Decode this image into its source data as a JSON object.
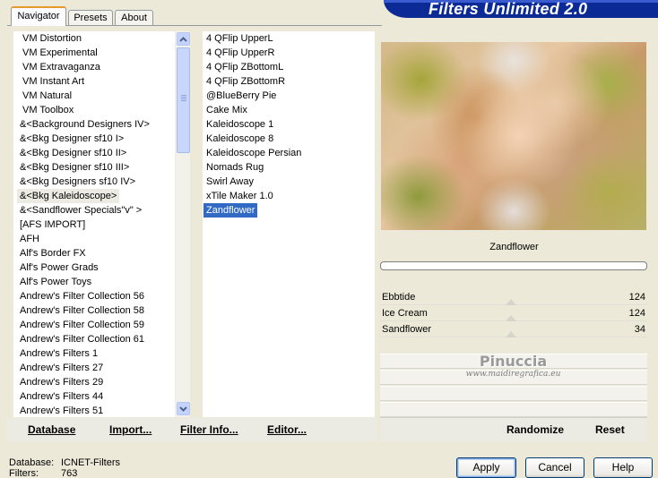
{
  "header": {
    "title": "Filters Unlimited 2.0"
  },
  "tabs": [
    {
      "label": "Navigator",
      "active": true
    },
    {
      "label": "Presets",
      "active": false
    },
    {
      "label": "About",
      "active": false
    }
  ],
  "categories": {
    "items": [
      "VM Distortion",
      "VM Experimental",
      "VM Extravaganza",
      "VM Instant Art",
      "VM Natural",
      "VM Toolbox",
      "&<Background Designers IV>",
      "&<Bkg Designer sf10 I>",
      "&<Bkg Designer sf10 II>",
      "&<Bkg Designer sf10 III>",
      "&<Bkg Designers sf10 IV>",
      "&<Bkg Kaleidoscope>",
      "&<Sandflower Specials\"v\" >",
      "[AFS IMPORT]",
      "AFH",
      "Alf's Border FX",
      "Alf's Power Grads",
      "Alf's Power Toys",
      "Andrew's Filter Collection 56",
      "Andrew's Filter Collection 58",
      "Andrew's Filter Collection 59",
      "Andrew's Filter Collection 61",
      "Andrew's Filters 1",
      "Andrew's Filters 27",
      "Andrew's Filters 29",
      "Andrew's Filters 44",
      "Andrew's Filters 51"
    ],
    "highlighted_index": 11
  },
  "filters": {
    "items": [
      "4 QFlip UpperL",
      "4 QFlip UpperR",
      "4 QFlip ZBottomL",
      "4 QFlip ZBottomR",
      "@BlueBerry Pie",
      "Cake Mix",
      "Kaleidoscope 1",
      "Kaleidoscope 8",
      "Kaleidoscope Persian",
      "Nomads Rug",
      "Swirl Away",
      "xTile Maker 1.0",
      "Zandflower"
    ],
    "selected_index": 12
  },
  "list_buttons": {
    "database": "Database",
    "import": "Import...",
    "filter_info": "Filter Info...",
    "editor": "Editor..."
  },
  "preview": {
    "filter_name": "Zandflower"
  },
  "parameters": [
    {
      "name": "Ebbtide",
      "value": "124"
    },
    {
      "name": "Ice Cream",
      "value": "124"
    },
    {
      "name": "Sandflower",
      "value": "34"
    }
  ],
  "watermark": {
    "name": "Pinuccia",
    "url": "www.maidiregrafica.eu"
  },
  "right_buttons": {
    "randomize": "Randomize",
    "reset": "Reset"
  },
  "status": {
    "database_label": "Database:",
    "database_value": "ICNET-Filters",
    "filters_label": "Filters:",
    "filters_value": "763"
  },
  "dialog_buttons": {
    "apply": "Apply",
    "cancel": "Cancel",
    "help": "Help"
  },
  "colors": {
    "banner": "#0c2a96",
    "selection": "#316ac5",
    "tab_accent": "#e69a2b"
  }
}
